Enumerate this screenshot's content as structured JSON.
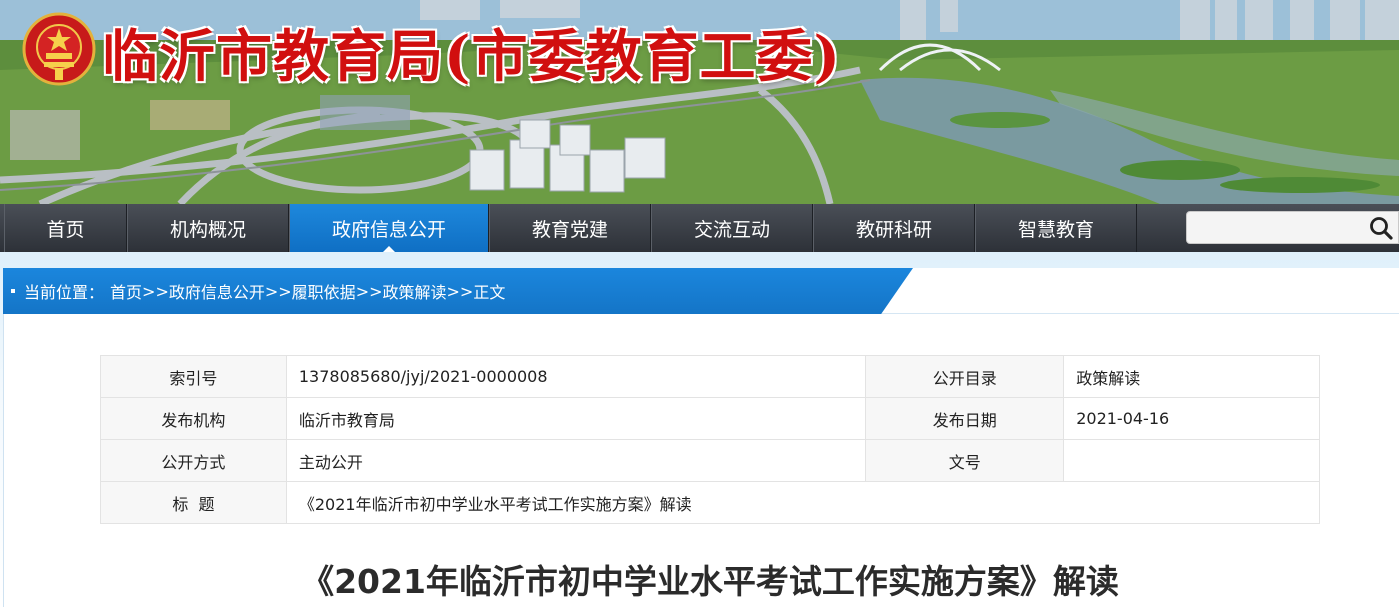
{
  "banner": {
    "site_title": "临沂市教育局(市委教育工委)"
  },
  "nav": {
    "items": [
      {
        "label": "首页"
      },
      {
        "label": "机构概况"
      },
      {
        "label": "政府信息公开",
        "active": true
      },
      {
        "label": "教育党建"
      },
      {
        "label": "交流互动"
      },
      {
        "label": "教研科研"
      },
      {
        "label": "智慧教育"
      }
    ],
    "search": {
      "value": "",
      "placeholder": "",
      "icon": "search-icon"
    }
  },
  "breadcrumb": {
    "prefix": "当前位置：",
    "items": [
      "首页",
      "政府信息公开",
      "履职依据",
      "政策解读",
      "正文"
    ],
    "separator": ">>"
  },
  "meta_table": {
    "rows": [
      {
        "k1": "索引号",
        "v1": "1378085680/jyj/2021-0000008",
        "k2": "公开目录",
        "v2": "政策解读"
      },
      {
        "k1": "发布机构",
        "v1": "临沂市教育局",
        "k2": "发布日期",
        "v2": "2021-04-16"
      },
      {
        "k1": "公开方式",
        "v1": "主动公开",
        "k2": "文号",
        "v2": ""
      }
    ],
    "title_row": {
      "k": "标  题",
      "v": "《2021年临沂市初中学业水平考试工作实施方案》解读"
    }
  },
  "article": {
    "title": "《2021年临沂市初中学业水平考试工作实施方案》解读"
  },
  "colors": {
    "nav_active": "#1a80d8",
    "title_red": "#d10f0f",
    "crumb_blue": "#1b86dd"
  }
}
